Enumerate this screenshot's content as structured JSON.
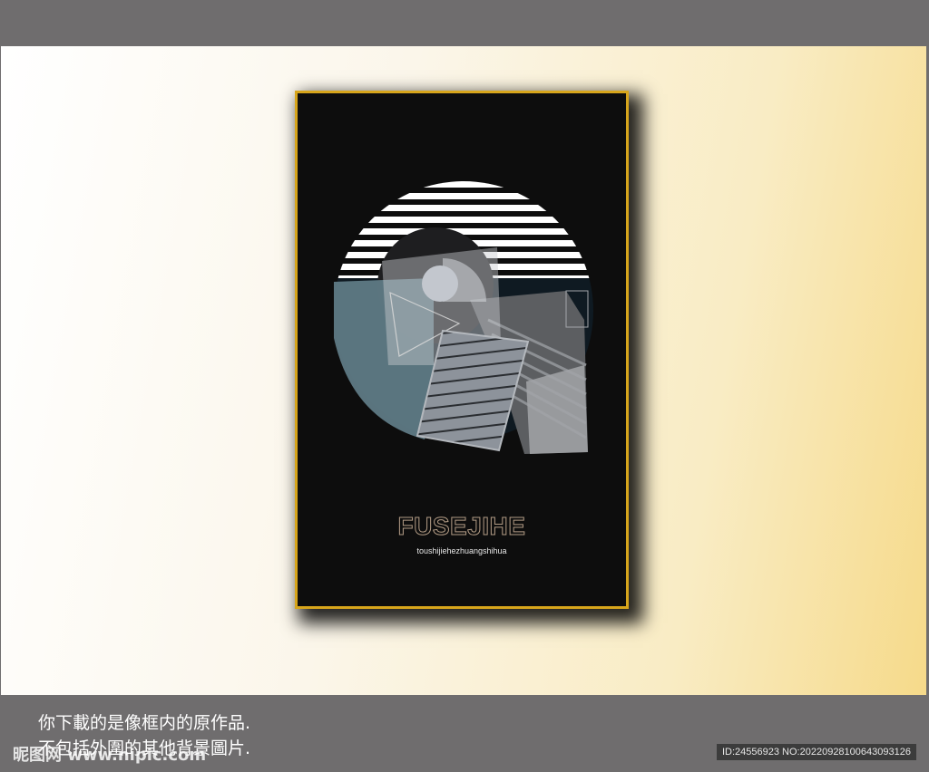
{
  "poster": {
    "title": "FUSEJIHE",
    "subtitle": "toushijiehezhuangshihua"
  },
  "notice": {
    "line1": "你下載的是像框内的原作品.",
    "line2": "不包括外圍的其他背景圖片."
  },
  "watermark": {
    "text": "昵图网 www.nipic.com"
  },
  "image_id": {
    "text": "ID:24556923 NO:20220928100643093126"
  },
  "colors": {
    "frame_gold": "#d7a51b",
    "poster_black": "#0d0d0d",
    "page_gray": "#6f6d6e",
    "steel_blue": "#5f7a85",
    "light_gray": "#b9bcc0"
  }
}
